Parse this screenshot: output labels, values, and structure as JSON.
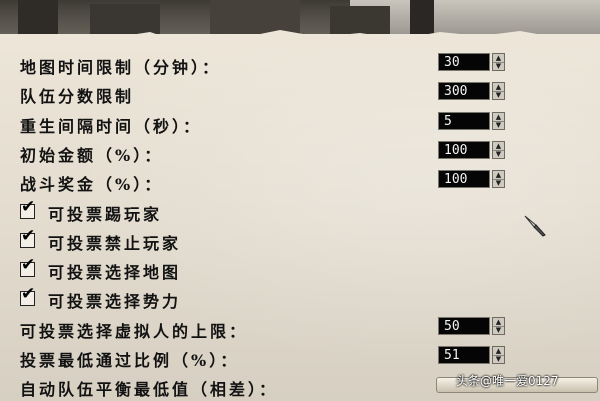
{
  "settings": [
    {
      "type": "number",
      "label": "地图时间限制（分钟）：",
      "value": "30"
    },
    {
      "type": "number",
      "label": "队伍分数限制",
      "value": "300"
    },
    {
      "type": "number",
      "label": "重生间隔时间（秒）：",
      "value": "5"
    },
    {
      "type": "number",
      "label": "初始金额（%）：",
      "value": "100"
    },
    {
      "type": "number",
      "label": "战斗奖金（%）：",
      "value": "100"
    },
    {
      "type": "checkbox",
      "label": "可投票踢玩家",
      "checked": true
    },
    {
      "type": "checkbox",
      "label": "可投票禁止玩家",
      "checked": true
    },
    {
      "type": "checkbox",
      "label": "可投票选择地图",
      "checked": true
    },
    {
      "type": "checkbox",
      "label": "可投票选择势力",
      "checked": true
    },
    {
      "type": "number",
      "label": "可投票选择虚拟人的上限：",
      "value": "50"
    },
    {
      "type": "number",
      "label": "投票最低通过比例（%）：",
      "value": "51"
    },
    {
      "type": "slider",
      "label": "自动队伍平衡最低值（相差）："
    }
  ],
  "icons": {
    "checkmark": "check-icon",
    "spin_up": "arrow-up-icon",
    "spin_down": "arrow-down-icon",
    "cursor": "sword-cursor-icon"
  },
  "watermark": "头条@唯一爱0127"
}
